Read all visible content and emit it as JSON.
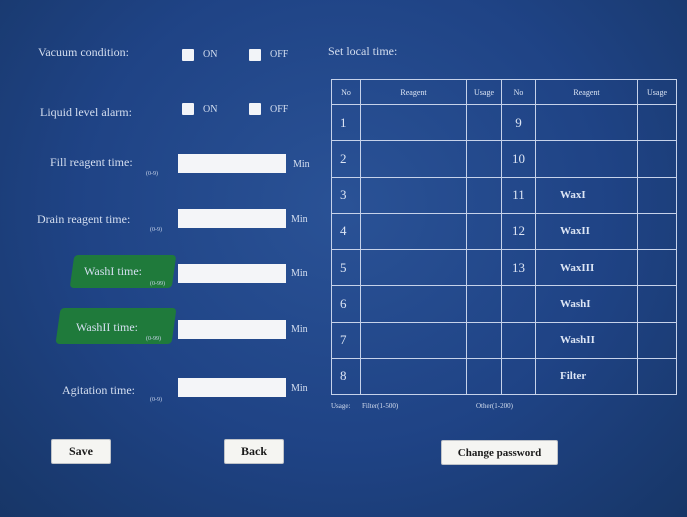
{
  "left_panel": {
    "vacuum": {
      "label": "Vacuum condition:",
      "on": "ON",
      "off": "OFF"
    },
    "liquid": {
      "label": "Liquid level alarm:",
      "on": "ON",
      "off": "OFF"
    },
    "fill": {
      "label": "Fill reagent time:",
      "hint": "(0-9)",
      "unit": "Min"
    },
    "drain": {
      "label": "Drain reagent time:",
      "hint": "(0-9)",
      "unit": "Min"
    },
    "wash1": {
      "label": "WashI time:",
      "hint": "(0-99)",
      "unit": "Min"
    },
    "wash2": {
      "label": "WashII time:",
      "hint": "(0-99)",
      "unit": "Min"
    },
    "agitation": {
      "label": "Agitation time:",
      "hint": "(0-9)",
      "unit": "Min"
    }
  },
  "right_panel": {
    "title": "Set local time:",
    "headers": [
      "No",
      "Reagent",
      "Usage",
      "No",
      "Reagent",
      "Usage"
    ],
    "rows": [
      [
        "1",
        "",
        "",
        "9",
        "",
        ""
      ],
      [
        "2",
        "",
        "",
        "10",
        "",
        ""
      ],
      [
        "3",
        "",
        "",
        "11",
        "WaxI",
        ""
      ],
      [
        "4",
        "",
        "",
        "12",
        "WaxII",
        ""
      ],
      [
        "5",
        "",
        "",
        "13",
        "WaxIII",
        ""
      ],
      [
        "6",
        "",
        "",
        "",
        "WashI",
        ""
      ],
      [
        "7",
        "",
        "",
        "",
        "WashII",
        ""
      ],
      [
        "8",
        "",
        "",
        "",
        "Filter",
        ""
      ]
    ],
    "usage_label": "Usage:",
    "usage_filter": "Filter(1-500)",
    "usage_other": "Other(1-200)"
  },
  "buttons": {
    "save": "Save",
    "back": "Back",
    "change_password": "Change password"
  }
}
